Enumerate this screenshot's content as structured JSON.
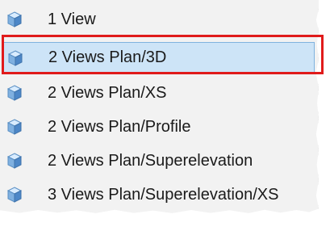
{
  "menu": {
    "items": [
      {
        "label": "1 View",
        "icon": "view-cube-icon"
      },
      {
        "label": "2 Views Plan/3D",
        "icon": "view-cube-icon",
        "selected": true
      },
      {
        "label": "2 Views Plan/XS",
        "icon": "view-cube-icon"
      },
      {
        "label": "2 Views Plan/Profile",
        "icon": "view-cube-icon"
      },
      {
        "label": "2 Views Plan/Superelevation",
        "icon": "view-cube-icon"
      },
      {
        "label": "3 Views Plan/Superelevation/XS",
        "icon": "view-cube-icon"
      }
    ]
  },
  "colors": {
    "highlight_border": "#e01b1b",
    "selected_background": "#cde4f7",
    "menu_background": "#f2f2f2"
  }
}
